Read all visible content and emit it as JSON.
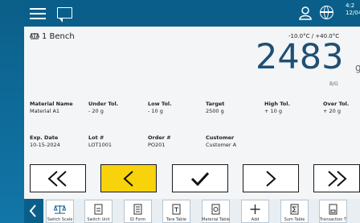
{
  "topbar": {
    "time_line1": "4:2",
    "time_line2": "12/04"
  },
  "scale": {
    "name": "1 Bench",
    "range": "-10.0°C / +40.0°C",
    "weight": "2483",
    "unit": "g",
    "weight_type": "B/G"
  },
  "fields": [
    {
      "label": "Material Name",
      "value": "Material A1"
    },
    {
      "label": "Under Tol.",
      "value": "- 20 g"
    },
    {
      "label": "Low Tol.",
      "value": "- 10 g"
    },
    {
      "label": "Target",
      "value": "2500 g"
    },
    {
      "label": "High Tol.",
      "value": "+ 10 g"
    },
    {
      "label": "Over Tol.",
      "value": "+ 20 g"
    },
    {
      "label": "Exp. Date",
      "value": "10-15-2024"
    },
    {
      "label": "Lot #",
      "value": "LOT1001"
    },
    {
      "label": "Order #",
      "value": "PO201"
    },
    {
      "label": "Customer",
      "value": "Customer A"
    }
  ],
  "softkeys": [
    {
      "label": "Switch Scale",
      "icon": "switch-scale-icon"
    },
    {
      "label": "Switch Unit",
      "icon": "switch-unit-icon"
    },
    {
      "label": "ID Form",
      "icon": "id-form-icon"
    },
    {
      "label": "Tare Table",
      "icon": "tare-table-icon"
    },
    {
      "label": "Material Table",
      "icon": "material-table-icon"
    },
    {
      "label": "Add",
      "icon": "add-icon"
    },
    {
      "label": "Sum Table",
      "icon": "sum-table-icon"
    },
    {
      "label": "Transaction T",
      "icon": "transaction-table-icon"
    }
  ],
  "colors": {
    "accent": "#0a5f8a",
    "active_button": "#f8d30b",
    "weight_text": "#1f4f74"
  }
}
